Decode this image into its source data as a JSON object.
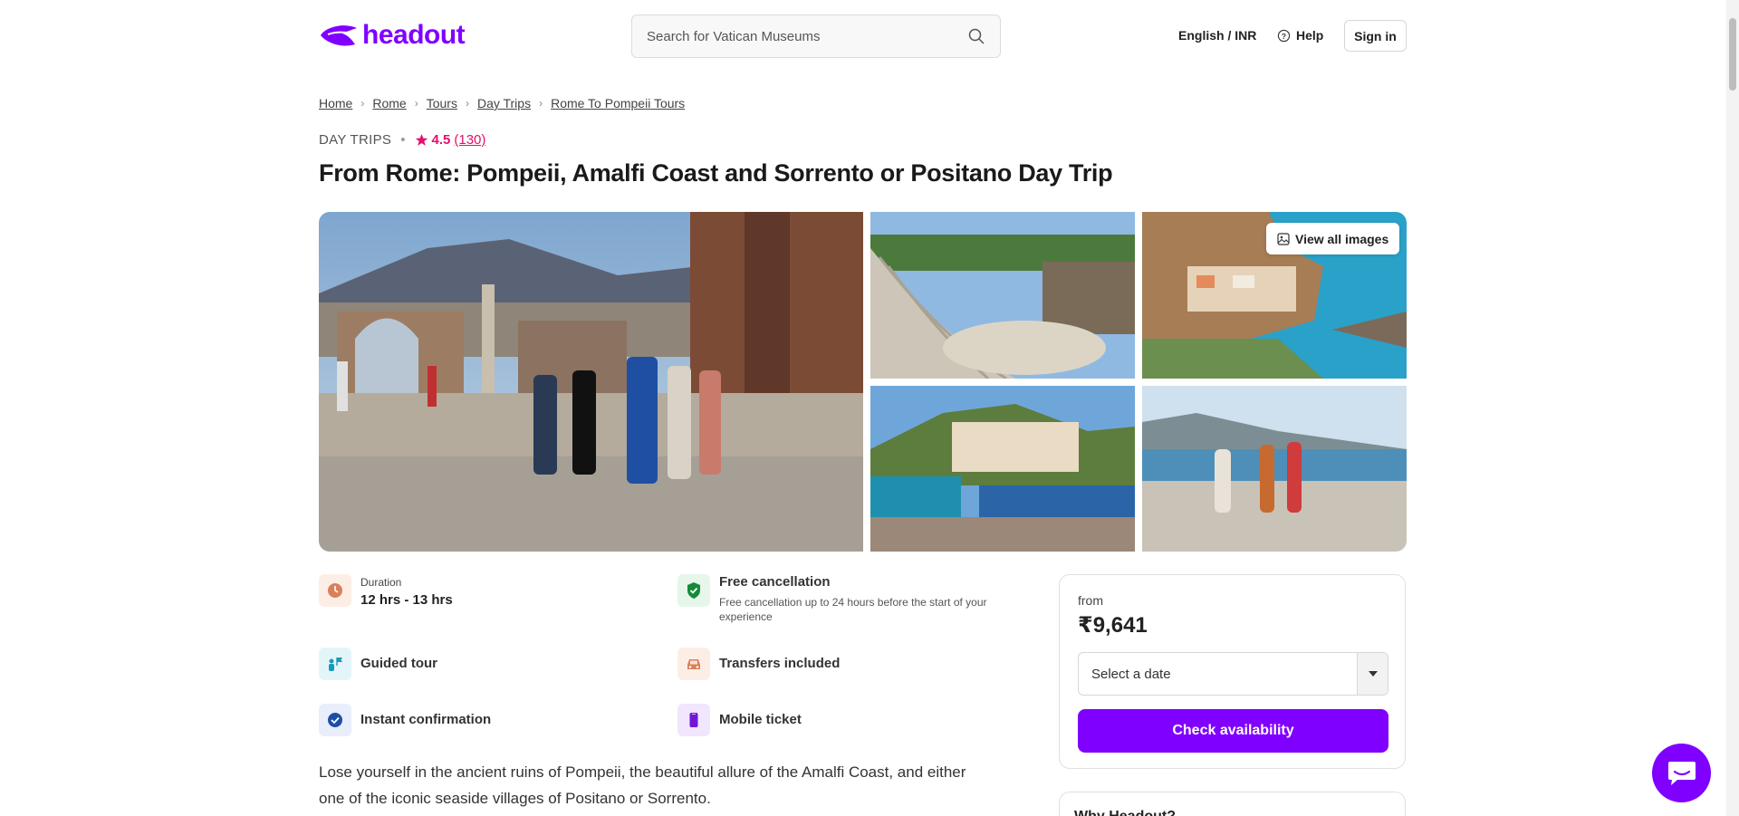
{
  "header": {
    "logo_text": "headout",
    "search_placeholder": "Search for Vatican Museums",
    "language": "English / INR",
    "help": "Help",
    "sign_in": "Sign in",
    "brand_color": "#8000ff"
  },
  "breadcrumb": [
    "Home",
    "Rome",
    "Tours",
    "Day Trips",
    "Rome To Pompeii Tours"
  ],
  "product": {
    "category": "DAY TRIPS",
    "rating": "4.5",
    "rating_count": "(130)",
    "title": "From Rome: Pompeii, Amalfi Coast and Sorrento or Positano Day Trip"
  },
  "gallery": {
    "view_all": "View all images"
  },
  "highlights": {
    "duration_label": "Duration",
    "duration_value": "12 hrs - 13 hrs",
    "free_cancel_title": "Free cancellation",
    "free_cancel_sub": "Free cancellation up to 24 hours before the start of your experience",
    "guided": "Guided tour",
    "transfers": "Transfers included",
    "instant": "Instant confirmation",
    "mobile": "Mobile ticket"
  },
  "description": "Lose yourself in the ancient ruins of Pompeii, the beautiful allure of the Amalfi Coast, and either one of the iconic seaside villages of Positano or Sorrento.",
  "booking": {
    "from": "from",
    "price": "₹9,641",
    "date_placeholder": "Select a date",
    "cta": "Check availability"
  },
  "why": "Why Headout?"
}
